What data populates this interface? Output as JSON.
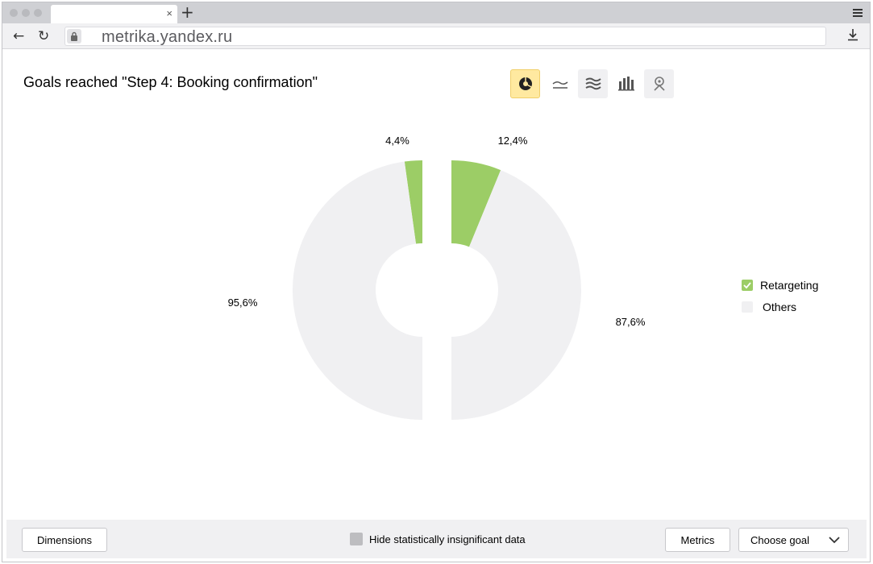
{
  "browser": {
    "url": "metrika.yandex.ru",
    "tab_close": "×",
    "new_tab": "+"
  },
  "page": {
    "title": "Goals reached \"Step 4: Booking confirmation\""
  },
  "chart_switcher": [
    {
      "icon": "pie-chart-icon",
      "active": true
    },
    {
      "icon": "line-chart-icon",
      "active": false
    },
    {
      "icon": "area-chart-icon",
      "active": false
    },
    {
      "icon": "bar-chart-icon",
      "active": false
    },
    {
      "icon": "map-icon",
      "active": false
    }
  ],
  "colors": {
    "retargeting": "#9ccd66",
    "others": "#f0f0f2",
    "active_switch": "#ffe9a0"
  },
  "chart_data": [
    {
      "type": "pie",
      "subtype": "half-donut-left",
      "categories": [
        "Retargeting",
        "Others"
      ],
      "values": [
        4.4,
        95.6
      ],
      "labels": [
        "4,4%",
        "95,6%"
      ]
    },
    {
      "type": "pie",
      "subtype": "half-donut-right",
      "categories": [
        "Retargeting",
        "Others"
      ],
      "values": [
        12.4,
        87.6
      ],
      "labels": [
        "12,4%",
        "87,6%"
      ]
    }
  ],
  "legend": {
    "items": [
      {
        "label": "Retargeting",
        "checked": true
      },
      {
        "label": "Others",
        "checked": false
      }
    ]
  },
  "footer": {
    "dimensions_label": "Dimensions",
    "hide_insignificant_label": "Hide statistically insignificant data",
    "metrics_label": "Metrics",
    "choose_goal_label": "Choose goal"
  }
}
